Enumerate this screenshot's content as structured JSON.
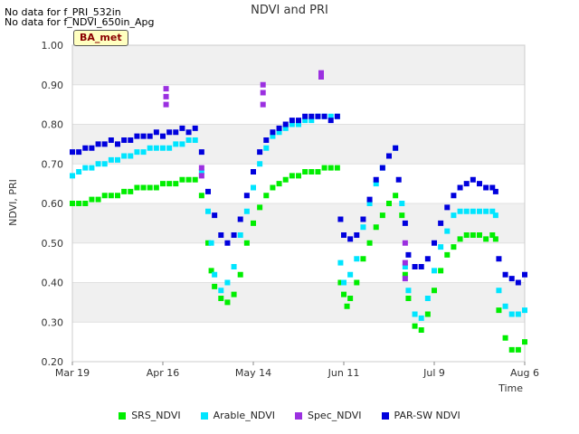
{
  "notes": [
    "No data for f_PRI_532in",
    "No data for f_NDVI_650in_Apg"
  ],
  "badge": "BA_met",
  "chart_data": {
    "type": "scatter",
    "title": "NDVI and PRI",
    "xlabel": "Time",
    "ylabel": "NDVI, PRI",
    "ylim": [
      0.2,
      1.0
    ],
    "xlim": [
      0,
      140
    ],
    "yticks": [
      "0.20",
      "0.30",
      "0.40",
      "0.50",
      "0.60",
      "0.70",
      "0.80",
      "0.90",
      "1.00"
    ],
    "xticks": [
      {
        "label": "Mar 19",
        "day": 0
      },
      {
        "label": "Apr 16",
        "day": 28
      },
      {
        "label": "May 14",
        "day": 56
      },
      {
        "label": "Jun 11",
        "day": 84
      },
      {
        "label": "Jul 9",
        "day": 112
      },
      {
        "label": "Aug 6",
        "day": 140
      }
    ],
    "grid": "horizontal bands",
    "legend_position": "bottom",
    "series": [
      {
        "name": "SRS_NDVI",
        "color": "#00ee00",
        "points": [
          [
            0,
            0.6
          ],
          [
            2,
            0.6
          ],
          [
            4,
            0.6
          ],
          [
            6,
            0.61
          ],
          [
            8,
            0.61
          ],
          [
            10,
            0.62
          ],
          [
            12,
            0.62
          ],
          [
            14,
            0.62
          ],
          [
            16,
            0.63
          ],
          [
            18,
            0.63
          ],
          [
            20,
            0.64
          ],
          [
            22,
            0.64
          ],
          [
            24,
            0.64
          ],
          [
            26,
            0.64
          ],
          [
            28,
            0.65
          ],
          [
            30,
            0.65
          ],
          [
            32,
            0.65
          ],
          [
            34,
            0.66
          ],
          [
            36,
            0.66
          ],
          [
            38,
            0.66
          ],
          [
            40,
            0.62
          ],
          [
            42,
            0.5
          ],
          [
            43,
            0.43
          ],
          [
            44,
            0.39
          ],
          [
            46,
            0.36
          ],
          [
            48,
            0.35
          ],
          [
            50,
            0.37
          ],
          [
            52,
            0.42
          ],
          [
            54,
            0.5
          ],
          [
            56,
            0.55
          ],
          [
            58,
            0.59
          ],
          [
            60,
            0.62
          ],
          [
            62,
            0.64
          ],
          [
            64,
            0.65
          ],
          [
            66,
            0.66
          ],
          [
            68,
            0.67
          ],
          [
            70,
            0.67
          ],
          [
            72,
            0.68
          ],
          [
            74,
            0.68
          ],
          [
            76,
            0.68
          ],
          [
            78,
            0.69
          ],
          [
            80,
            0.69
          ],
          [
            82,
            0.69
          ],
          [
            83,
            0.4
          ],
          [
            84,
            0.37
          ],
          [
            85,
            0.34
          ],
          [
            86,
            0.36
          ],
          [
            88,
            0.4
          ],
          [
            90,
            0.46
          ],
          [
            92,
            0.5
          ],
          [
            94,
            0.54
          ],
          [
            96,
            0.57
          ],
          [
            98,
            0.6
          ],
          [
            100,
            0.62
          ],
          [
            102,
            0.57
          ],
          [
            103,
            0.42
          ],
          [
            104,
            0.36
          ],
          [
            106,
            0.29
          ],
          [
            108,
            0.28
          ],
          [
            110,
            0.32
          ],
          [
            112,
            0.38
          ],
          [
            114,
            0.43
          ],
          [
            116,
            0.47
          ],
          [
            118,
            0.49
          ],
          [
            120,
            0.51
          ],
          [
            122,
            0.52
          ],
          [
            124,
            0.52
          ],
          [
            126,
            0.52
          ],
          [
            128,
            0.51
          ],
          [
            130,
            0.52
          ],
          [
            131,
            0.51
          ],
          [
            132,
            0.33
          ],
          [
            134,
            0.26
          ],
          [
            136,
            0.23
          ],
          [
            138,
            0.23
          ],
          [
            140,
            0.25
          ]
        ]
      },
      {
        "name": "Arable_NDVI",
        "color": "#00e5ff",
        "points": [
          [
            0,
            0.67
          ],
          [
            2,
            0.68
          ],
          [
            4,
            0.69
          ],
          [
            6,
            0.69
          ],
          [
            8,
            0.7
          ],
          [
            10,
            0.7
          ],
          [
            12,
            0.71
          ],
          [
            14,
            0.71
          ],
          [
            16,
            0.72
          ],
          [
            18,
            0.72
          ],
          [
            20,
            0.73
          ],
          [
            22,
            0.73
          ],
          [
            24,
            0.74
          ],
          [
            26,
            0.74
          ],
          [
            28,
            0.74
          ],
          [
            30,
            0.74
          ],
          [
            32,
            0.75
          ],
          [
            34,
            0.75
          ],
          [
            36,
            0.76
          ],
          [
            38,
            0.76
          ],
          [
            40,
            0.68
          ],
          [
            42,
            0.58
          ],
          [
            43,
            0.5
          ],
          [
            44,
            0.42
          ],
          [
            46,
            0.38
          ],
          [
            48,
            0.4
          ],
          [
            50,
            0.44
          ],
          [
            52,
            0.52
          ],
          [
            54,
            0.58
          ],
          [
            56,
            0.64
          ],
          [
            58,
            0.7
          ],
          [
            60,
            0.74
          ],
          [
            62,
            0.77
          ],
          [
            64,
            0.78
          ],
          [
            66,
            0.79
          ],
          [
            68,
            0.8
          ],
          [
            70,
            0.8
          ],
          [
            72,
            0.81
          ],
          [
            74,
            0.81
          ],
          [
            76,
            0.82
          ],
          [
            78,
            0.82
          ],
          [
            80,
            0.82
          ],
          [
            82,
            0.82
          ],
          [
            83,
            0.45
          ],
          [
            84,
            0.4
          ],
          [
            86,
            0.42
          ],
          [
            88,
            0.46
          ],
          [
            90,
            0.54
          ],
          [
            92,
            0.6
          ],
          [
            94,
            0.65
          ],
          [
            96,
            0.69
          ],
          [
            98,
            0.72
          ],
          [
            100,
            0.74
          ],
          [
            102,
            0.6
          ],
          [
            103,
            0.44
          ],
          [
            104,
            0.38
          ],
          [
            106,
            0.32
          ],
          [
            108,
            0.31
          ],
          [
            110,
            0.36
          ],
          [
            112,
            0.43
          ],
          [
            114,
            0.49
          ],
          [
            116,
            0.53
          ],
          [
            118,
            0.57
          ],
          [
            120,
            0.58
          ],
          [
            122,
            0.58
          ],
          [
            124,
            0.58
          ],
          [
            126,
            0.58
          ],
          [
            128,
            0.58
          ],
          [
            130,
            0.58
          ],
          [
            131,
            0.57
          ],
          [
            132,
            0.38
          ],
          [
            134,
            0.34
          ],
          [
            136,
            0.32
          ],
          [
            138,
            0.32
          ],
          [
            140,
            0.33
          ]
        ]
      },
      {
        "name": "Spec_NDVI",
        "color": "#9b30e0",
        "points": [
          [
            29,
            0.85
          ],
          [
            29,
            0.87
          ],
          [
            29,
            0.89
          ],
          [
            40,
            0.69
          ],
          [
            40,
            0.67
          ],
          [
            59,
            0.85
          ],
          [
            59,
            0.88
          ],
          [
            59,
            0.9
          ],
          [
            77,
            0.92
          ],
          [
            77,
            0.93
          ],
          [
            103,
            0.5
          ],
          [
            103,
            0.45
          ],
          [
            103,
            0.41
          ]
        ]
      },
      {
        "name": "PAR-SW NDVI",
        "color": "#0000dd",
        "points": [
          [
            0,
            0.73
          ],
          [
            2,
            0.73
          ],
          [
            4,
            0.74
          ],
          [
            6,
            0.74
          ],
          [
            8,
            0.75
          ],
          [
            10,
            0.75
          ],
          [
            12,
            0.76
          ],
          [
            14,
            0.75
          ],
          [
            16,
            0.76
          ],
          [
            18,
            0.76
          ],
          [
            20,
            0.77
          ],
          [
            22,
            0.77
          ],
          [
            24,
            0.77
          ],
          [
            26,
            0.78
          ],
          [
            28,
            0.77
          ],
          [
            30,
            0.78
          ],
          [
            32,
            0.78
          ],
          [
            34,
            0.79
          ],
          [
            36,
            0.78
          ],
          [
            38,
            0.79
          ],
          [
            40,
            0.73
          ],
          [
            42,
            0.63
          ],
          [
            44,
            0.57
          ],
          [
            46,
            0.52
          ],
          [
            48,
            0.5
          ],
          [
            50,
            0.52
          ],
          [
            52,
            0.56
          ],
          [
            54,
            0.62
          ],
          [
            56,
            0.68
          ],
          [
            58,
            0.73
          ],
          [
            60,
            0.76
          ],
          [
            62,
            0.78
          ],
          [
            64,
            0.79
          ],
          [
            66,
            0.8
          ],
          [
            68,
            0.81
          ],
          [
            70,
            0.81
          ],
          [
            72,
            0.82
          ],
          [
            74,
            0.82
          ],
          [
            76,
            0.82
          ],
          [
            78,
            0.82
          ],
          [
            80,
            0.81
          ],
          [
            82,
            0.82
          ],
          [
            83,
            0.56
          ],
          [
            84,
            0.52
          ],
          [
            86,
            0.51
          ],
          [
            88,
            0.52
          ],
          [
            90,
            0.56
          ],
          [
            92,
            0.61
          ],
          [
            94,
            0.66
          ],
          [
            96,
            0.69
          ],
          [
            98,
            0.72
          ],
          [
            100,
            0.74
          ],
          [
            101,
            0.66
          ],
          [
            103,
            0.55
          ],
          [
            104,
            0.47
          ],
          [
            106,
            0.44
          ],
          [
            108,
            0.44
          ],
          [
            110,
            0.46
          ],
          [
            112,
            0.5
          ],
          [
            114,
            0.55
          ],
          [
            116,
            0.59
          ],
          [
            118,
            0.62
          ],
          [
            120,
            0.64
          ],
          [
            122,
            0.65
          ],
          [
            124,
            0.66
          ],
          [
            126,
            0.65
          ],
          [
            128,
            0.64
          ],
          [
            130,
            0.64
          ],
          [
            131,
            0.63
          ],
          [
            132,
            0.46
          ],
          [
            134,
            0.42
          ],
          [
            136,
            0.41
          ],
          [
            138,
            0.4
          ],
          [
            140,
            0.42
          ]
        ]
      }
    ]
  }
}
